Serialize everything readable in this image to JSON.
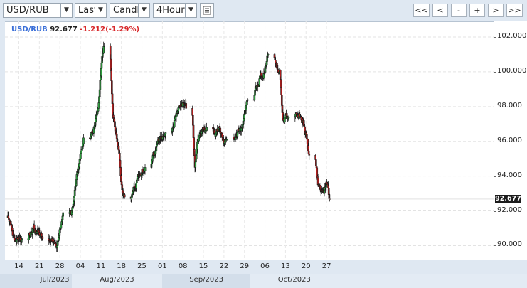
{
  "toolbar": {
    "symbol": "USD/RUB",
    "price_mode": "Last",
    "chart_style": "Candle",
    "interval": "4Hour",
    "nav": [
      "<<",
      "<",
      "-",
      "+",
      ">",
      ">>"
    ]
  },
  "legend": {
    "symbol": "USD/RUB",
    "price": "92.677",
    "change": "-1.212(-1.29%)"
  },
  "colors": {
    "up": "#2e9e3e",
    "down": "#b01e1e",
    "symbol_blue": "#3a6fd8",
    "change_red": "#d8282a"
  },
  "chart_data": {
    "type": "candlestick",
    "series_name": "USD/RUB",
    "interval": "4Hour",
    "last_price": 92.677,
    "ylim": [
      89.2,
      102.9
    ],
    "y_ticks": [
      "102.000",
      "100.000",
      "98.000",
      "96.000",
      "94.000",
      "92.000",
      "90.000"
    ],
    "x_ticks": [
      "14",
      "21",
      "28",
      "04",
      "11",
      "18",
      "25",
      "01",
      "08",
      "15",
      "22",
      "29",
      "06",
      "13",
      "20",
      "27"
    ],
    "months": [
      "Jul/2023",
      "Aug/2023",
      "Sep/2023",
      "Oct/2023"
    ],
    "grid": true,
    "daily_close": [
      [
        "Jul 10",
        91.4
      ],
      [
        "Jul 11",
        90.6
      ],
      [
        "Jul 12",
        90.2
      ],
      [
        "Jul 13",
        90.5
      ],
      [
        "Jul 14",
        90.4
      ],
      [
        "Jul 17",
        90.8
      ],
      [
        "Jul 18",
        91.2
      ],
      [
        "Jul 19",
        90.7
      ],
      [
        "Jul 20",
        90.6
      ],
      [
        "Jul 21",
        90.4
      ],
      [
        "Jul 24",
        90.3
      ],
      [
        "Jul 25",
        90.2
      ],
      [
        "Jul 26",
        90.0
      ],
      [
        "Jul 27",
        91.0
      ],
      [
        "Jul 28",
        91.9
      ],
      [
        "Jul 31",
        92.0
      ],
      [
        "Aug 01",
        93.2
      ],
      [
        "Aug 02",
        94.2
      ],
      [
        "Aug 03",
        95.3
      ],
      [
        "Aug 04",
        96.2
      ],
      [
        "Aug 07",
        96.6
      ],
      [
        "Aug 08",
        97.1
      ],
      [
        "Aug 09",
        97.9
      ],
      [
        "Aug 10",
        100.2
      ],
      [
        "Aug 11",
        101.5
      ],
      [
        "Aug 14",
        97.5
      ],
      [
        "Aug 15",
        96.5
      ],
      [
        "Aug 16",
        95.5
      ],
      [
        "Aug 17",
        93.5
      ],
      [
        "Aug 18",
        92.8
      ],
      [
        "Aug 21",
        93.1
      ],
      [
        "Aug 22",
        93.6
      ],
      [
        "Aug 23",
        94.1
      ],
      [
        "Aug 24",
        94.4
      ],
      [
        "Aug 25",
        94.5
      ],
      [
        "Aug 28",
        95.2
      ],
      [
        "Aug 29",
        95.8
      ],
      [
        "Aug 30",
        96.1
      ],
      [
        "Aug 31",
        96.3
      ],
      [
        "Sep 01",
        96.5
      ],
      [
        "Sep 04",
        97.2
      ],
      [
        "Sep 05",
        97.7
      ],
      [
        "Sep 06",
        98.0
      ],
      [
        "Sep 07",
        98.2
      ],
      [
        "Sep 08",
        97.9
      ],
      [
        "Sep 11",
        94.5
      ],
      [
        "Sep 12",
        96.1
      ],
      [
        "Sep 13",
        96.3
      ],
      [
        "Sep 14",
        96.8
      ],
      [
        "Sep 15",
        96.8
      ],
      [
        "Sep 18",
        96.3
      ],
      [
        "Sep 19",
        96.7
      ],
      [
        "Sep 20",
        96.4
      ],
      [
        "Sep 21",
        95.9
      ],
      [
        "Sep 22",
        96.1
      ],
      [
        "Sep 25",
        96.3
      ],
      [
        "Sep 26",
        96.6
      ],
      [
        "Sep 27",
        96.8
      ],
      [
        "Sep 28",
        97.6
      ],
      [
        "Sep 29",
        98.4
      ],
      [
        "Oct 02",
        99.1
      ],
      [
        "Oct 03",
        99.6
      ],
      [
        "Oct 04",
        99.7
      ],
      [
        "Oct 05",
        100.3
      ],
      [
        "Oct 06",
        101.0
      ],
      [
        "Oct 09",
        100.2
      ],
      [
        "Oct 10",
        100.1
      ],
      [
        "Oct 11",
        97.3
      ],
      [
        "Oct 12",
        97.5
      ],
      [
        "Oct 13",
        97.4
      ],
      [
        "Oct 16",
        97.5
      ],
      [
        "Oct 17",
        97.4
      ],
      [
        "Oct 18",
        97.2
      ],
      [
        "Oct 19",
        96.4
      ],
      [
        "Oct 20",
        95.2
      ],
      [
        "Oct 23",
        93.5
      ],
      [
        "Oct 24",
        93.1
      ],
      [
        "Oct 25",
        93.0
      ],
      [
        "Oct 26",
        93.6
      ],
      [
        "Oct 27",
        92.677
      ]
    ]
  }
}
